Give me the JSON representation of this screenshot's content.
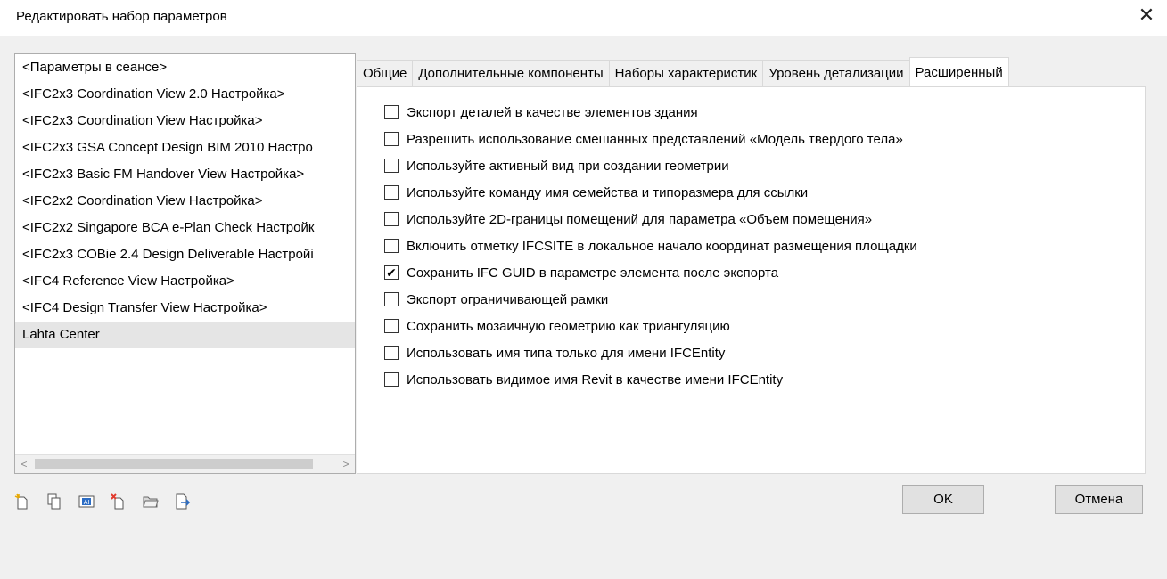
{
  "window": {
    "title": "Редактировать набор параметров",
    "close_glyph": "✕"
  },
  "config_list": {
    "items": [
      "<Параметры в сеансе>",
      "<IFC2x3 Coordination View 2.0 Настройка>",
      "<IFC2x3 Coordination View Настройка>",
      "<IFC2x3 GSA Concept Design BIM 2010 Настро",
      "<IFC2x3 Basic FM Handover View Настройка>",
      "<IFC2x2 Coordination View Настройка>",
      "<IFC2x2 Singapore BCA e-Plan Check Настройк",
      "<IFC2x3 COBie 2.4 Design Deliverable Настройі",
      "<IFC4 Reference View Настройка>",
      "<IFC4 Design Transfer View Настройка>",
      "Lahta Center"
    ],
    "selected_index": 10,
    "scroll_left_glyph": "<",
    "scroll_right_glyph": ">"
  },
  "tabs": [
    "Общие",
    "Дополнительные компоненты",
    "Наборы характеристик",
    "Уровень детализации",
    "Расширенный"
  ],
  "active_tab_index": 4,
  "options": [
    {
      "label": "Экспорт деталей в качестве элементов здания",
      "checked": false
    },
    {
      "label": "Разрешить использование смешанных представлений «Модель твердого тела»",
      "checked": false
    },
    {
      "label": "Используйте активный вид при создании геометрии",
      "checked": false
    },
    {
      "label": "Используйте команду имя семейства и типоразмера для ссылки",
      "checked": false
    },
    {
      "label": "Используйте 2D-границы помещений для параметра «Объем помещения»",
      "checked": false
    },
    {
      "label": "Включить отметку IFCSITE в локальное начало координат размещения площадки",
      "checked": false
    },
    {
      "label": "Сохранить IFC GUID в параметре элемента после экспорта",
      "checked": true
    },
    {
      "label": "Экспорт ограничивающей рамки",
      "checked": false
    },
    {
      "label": "Сохранить мозаичную геометрию как триангуляцию",
      "checked": false
    },
    {
      "label": "Использовать имя типа только для имени IFCEntity",
      "checked": false
    },
    {
      "label": "Использовать видимое имя Revit в качестве имени IFCEntity",
      "checked": false
    }
  ],
  "toolbar_icons": [
    "new-setup-icon",
    "duplicate-setup-icon",
    "rename-setup-icon",
    "delete-setup-icon",
    "import-setup-icon",
    "export-setup-icon"
  ],
  "buttons": {
    "ok": "OK",
    "cancel": "Отмена"
  },
  "colors": {
    "accent": "#0066cc",
    "delete": "#e23b2e",
    "button_bg": "#e1e1e1"
  }
}
